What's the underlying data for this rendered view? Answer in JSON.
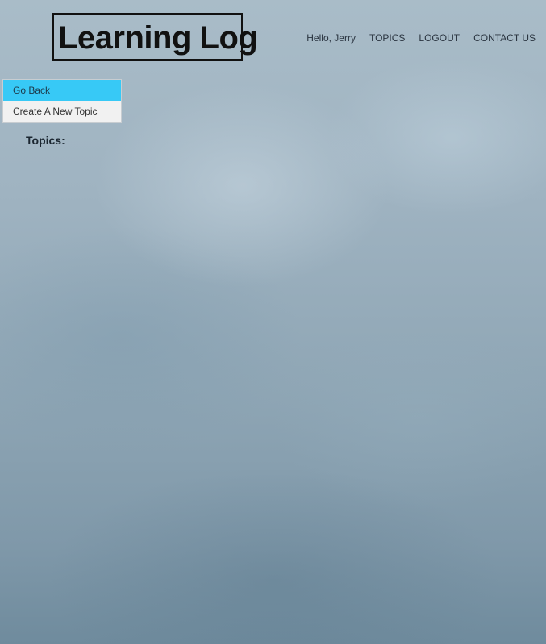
{
  "header": {
    "logo_text": "Learning Log",
    "nav": {
      "greeting": "Hello, Jerry",
      "topics": "TOPICS",
      "logout": "LOGOUT",
      "contact": "CONTACT US"
    }
  },
  "sidebar": {
    "items": [
      {
        "label": "Go Back",
        "active": true
      },
      {
        "label": "Create A New Topic",
        "active": false
      }
    ]
  },
  "main": {
    "topics_heading": "Topics:"
  },
  "colors": {
    "accent": "#37c9f6",
    "text_dark": "#111111"
  }
}
